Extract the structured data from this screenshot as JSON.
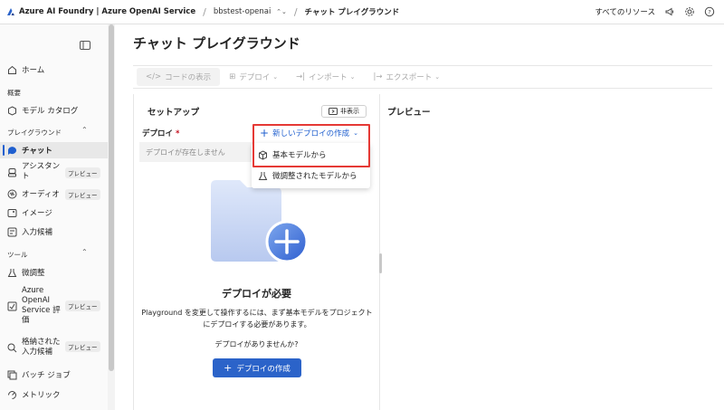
{
  "topbar": {
    "brand": "Azure AI Foundry | Azure OpenAI Service",
    "resource": "bbstest-openai",
    "current_page": "チャット プレイグラウンド",
    "all_resources": "すべてのリソース"
  },
  "sidebar": {
    "home": "ホーム",
    "section_overview": "概要",
    "model_catalog": "モデル カタログ",
    "section_playground": "プレイグラウンド",
    "chat": "チャット",
    "assistant": "アシスタント",
    "audio": "オーディオ",
    "image": "イメージ",
    "completions": "入力候補",
    "section_tools": "ツール",
    "finetune": "微調整",
    "eval": "Azure OpenAI Service 評価",
    "stored": "格納された入力候補",
    "batch": "バッチ ジョブ",
    "metrics": "メトリック",
    "preview_badge": "プレビュー"
  },
  "main": {
    "title": "チャット プレイグラウンド",
    "toolbar": {
      "view_code": "コードの表示",
      "deploy": "デプロイ",
      "import": "インポート",
      "export": "エクスポート"
    },
    "setup": {
      "title": "セットアップ",
      "hide": "非表示",
      "deploy_label": "デプロイ",
      "required_mark": "*",
      "deploy_placeholder": "デプロイが存在しません",
      "need_title": "デプロイが必要",
      "need_desc": "Playground を変更して操作するには、まず基本モデルをプロジェクトにデプロイする必要があります。",
      "no_deploy": "デプロイがありませんか?",
      "create_button": "デプロイの作成"
    },
    "preview_title": "プレビュー",
    "new_deploy": {
      "label": "新しいデプロイの作成",
      "options": [
        "基本モデルから",
        "微調整されたモデルから"
      ]
    }
  },
  "colors": {
    "accent": "#2b63c9",
    "highlight_border": "#e53935"
  },
  "icons": {
    "brand": "azure-ai-logo",
    "megaphone": "megaphone-icon",
    "settings": "gear-icon",
    "help": "question-icon"
  }
}
